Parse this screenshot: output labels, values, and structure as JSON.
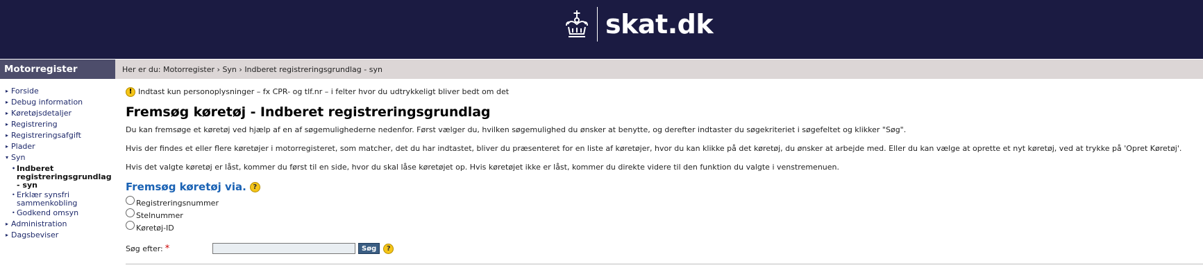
{
  "header": {
    "brand": "skat.dk",
    "crown_icon": "crown-icon"
  },
  "sidebar": {
    "title": "Motorregister",
    "items": [
      {
        "label": "Forside",
        "icon": "triangle-right-icon"
      },
      {
        "label": "Debug information",
        "icon": "triangle-right-icon"
      },
      {
        "label": "Køretøjsdetaljer",
        "icon": "triangle-right-icon"
      },
      {
        "label": "Registrering",
        "icon": "triangle-right-icon"
      },
      {
        "label": "Registreringsafgift",
        "icon": "triangle-right-icon"
      },
      {
        "label": "Plader",
        "icon": "triangle-right-icon"
      },
      {
        "label": "Syn",
        "icon": "triangle-down-icon"
      },
      {
        "label": "Indberet registreringsgrundlag - syn",
        "icon": "bullet-icon",
        "active": true
      },
      {
        "label": "Erklær synsfri sammenkobling",
        "icon": "bullet-icon"
      },
      {
        "label": "Godkend omsyn",
        "icon": "bullet-icon"
      },
      {
        "label": "Administration",
        "icon": "triangle-right-icon"
      },
      {
        "label": "Dagsbeviser",
        "icon": "triangle-right-icon"
      }
    ]
  },
  "breadcrumb": {
    "prefix": "Her er du:",
    "items": [
      "Motorregister",
      "Syn",
      "Indberet registreringsgrundlag - syn"
    ],
    "separator": "›"
  },
  "notice": {
    "icon": "exclamation-icon",
    "text": "Indtast kun personoplysninger – fx CPR- og tlf.nr – i felter hvor du udtrykkeligt bliver bedt om det"
  },
  "page": {
    "title": "Fremsøg køretøj - Indberet registreringsgrundlag",
    "paragraphs": [
      "Du kan fremsøge et køretøj ved hjælp af en af søgemulighederne nedenfor. Først vælger du, hvilken søgemulighed du ønsker at benytte, og derefter indtaster du søgekriteriet i søgefeltet og klikker \"Søg\".",
      "Hvis der findes et eller flere køretøjer i motorregisteret, som matcher, det du har indtastet, bliver du præsenteret for en liste af køretøjer, hvor du kan klikke på det køretøj, du ønsker at arbejde med. Eller du kan vælge at oprette et nyt køretøj, ved at trykke på 'Opret Køretøj'.",
      "Hvis det valgte køretøj er låst, kommer du først til en side, hvor du skal låse køretøjet op. Hvis køretøjet ikke er låst, kommer du direkte videre til den funktion du valgte i venstremenuen."
    ]
  },
  "search": {
    "heading": "Fremsøg køretøj via.",
    "help_symbol": "?",
    "options": [
      "Registreringsnummer",
      "Stelnummer",
      "Køretøj-ID"
    ],
    "label": "Søg efter:",
    "required_marker": "*",
    "input_value": "",
    "button_label": "Søg"
  },
  "colors": {
    "header_bg": "#1b1b42",
    "sidebar_header_bg": "#4d4d6b",
    "breadcrumb_bg": "#dcd6d6",
    "link": "#1f2a6b",
    "heading_blue": "#1a62b4",
    "help_yellow": "#f5c518"
  }
}
